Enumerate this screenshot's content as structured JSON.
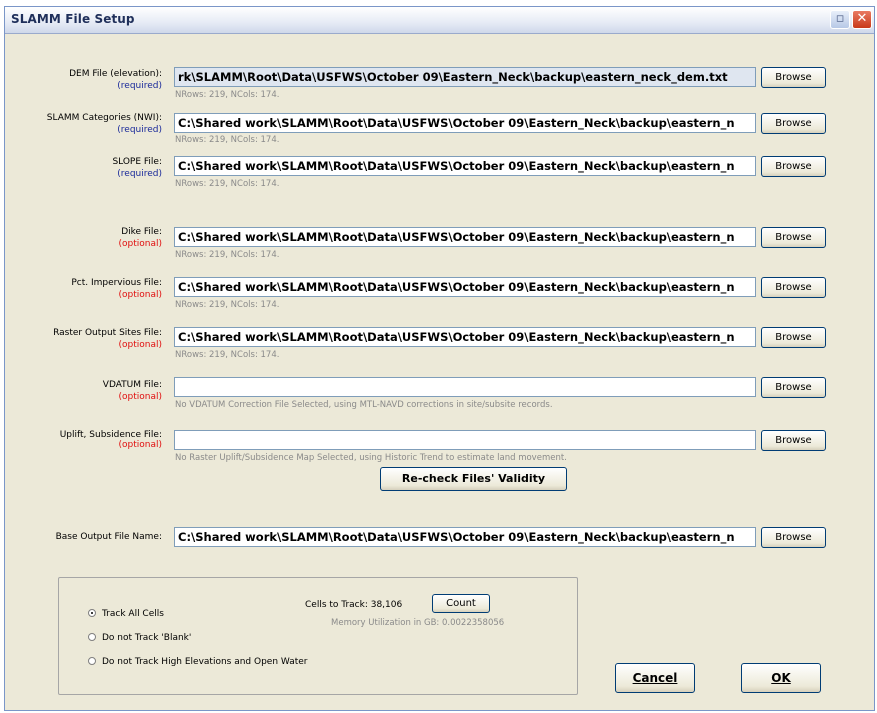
{
  "window": {
    "title": "SLAMM File Setup"
  },
  "colors": {
    "required": "#1a2a9a",
    "optional": "#e01010",
    "titlebar_close": "#c8391a"
  },
  "rows": [
    {
      "label": "DEM File (elevation):",
      "tag": "(required)",
      "kind": "req",
      "value": "rk\\SLAMM\\Root\\Data\\USFWS\\October 09\\Eastern_Neck\\backup\\eastern_neck_dem.txt",
      "info": "NRows: 219, NCols: 174.",
      "button": "Browse"
    },
    {
      "label": "SLAMM Categories (NWI):",
      "tag": "(required)",
      "kind": "req",
      "value": "C:\\Shared work\\SLAMM\\Root\\Data\\USFWS\\October 09\\Eastern_Neck\\backup\\eastern_n",
      "info": "NRows: 219, NCols: 174.",
      "button": "Browse"
    },
    {
      "label": "SLOPE File:",
      "tag": "(required)",
      "kind": "req",
      "value": "C:\\Shared work\\SLAMM\\Root\\Data\\USFWS\\October 09\\Eastern_Neck\\backup\\eastern_n",
      "info": "NRows: 219, NCols: 174.",
      "button": "Browse"
    },
    {
      "label": "Dike File:",
      "tag": "(optional)",
      "kind": "opt",
      "value": "C:\\Shared work\\SLAMM\\Root\\Data\\USFWS\\October 09\\Eastern_Neck\\backup\\eastern_n",
      "info": "NRows: 219, NCols: 174.",
      "button": "Browse"
    },
    {
      "label": "Pct. Impervious File:",
      "tag": "(optional)",
      "kind": "opt",
      "value": "C:\\Shared work\\SLAMM\\Root\\Data\\USFWS\\October 09\\Eastern_Neck\\backup\\eastern_n",
      "info": "NRows: 219, NCols: 174.",
      "button": "Browse"
    },
    {
      "label": "Raster Output Sites File:",
      "tag": "(optional)",
      "kind": "opt",
      "value": "C:\\Shared work\\SLAMM\\Root\\Data\\USFWS\\October 09\\Eastern_Neck\\backup\\eastern_n",
      "info": "NRows: 219, NCols: 174.",
      "button": "Browse"
    },
    {
      "label": "VDATUM File:",
      "tag": "(optional)",
      "kind": "opt",
      "value": "",
      "info": "No VDATUM Correction File Selected, using MTL-NAVD corrections in site/subsite records.",
      "button": "Browse"
    },
    {
      "label": "Uplift, Subsidence File:",
      "tag": "(optional)",
      "kind": "opt",
      "value": "",
      "info": "No Raster Uplift/Subsidence Map Selected, using Historic Trend to estimate land movement.",
      "button": "Browse"
    }
  ],
  "recheck_button": "Re-check Files' Validity",
  "base_output": {
    "label": "Base Output File Name:",
    "value": "C:\\Shared work\\SLAMM\\Root\\Data\\USFWS\\October 09\\Eastern_Neck\\backup\\eastern_n",
    "button": "Browse"
  },
  "tracking": {
    "options": [
      {
        "label": "Track All Cells",
        "selected": true
      },
      {
        "label": "Do not Track 'Blank'",
        "selected": false
      },
      {
        "label": "Do not Track High Elevations and Open Water",
        "selected": false
      }
    ],
    "cells_to_track_label": "Cells to Track: 38,106",
    "count_button": "Count",
    "memory_text": "Memory Utilization in GB: 0.0022358056"
  },
  "buttons": {
    "cancel": "Cancel",
    "ok": "OK"
  }
}
